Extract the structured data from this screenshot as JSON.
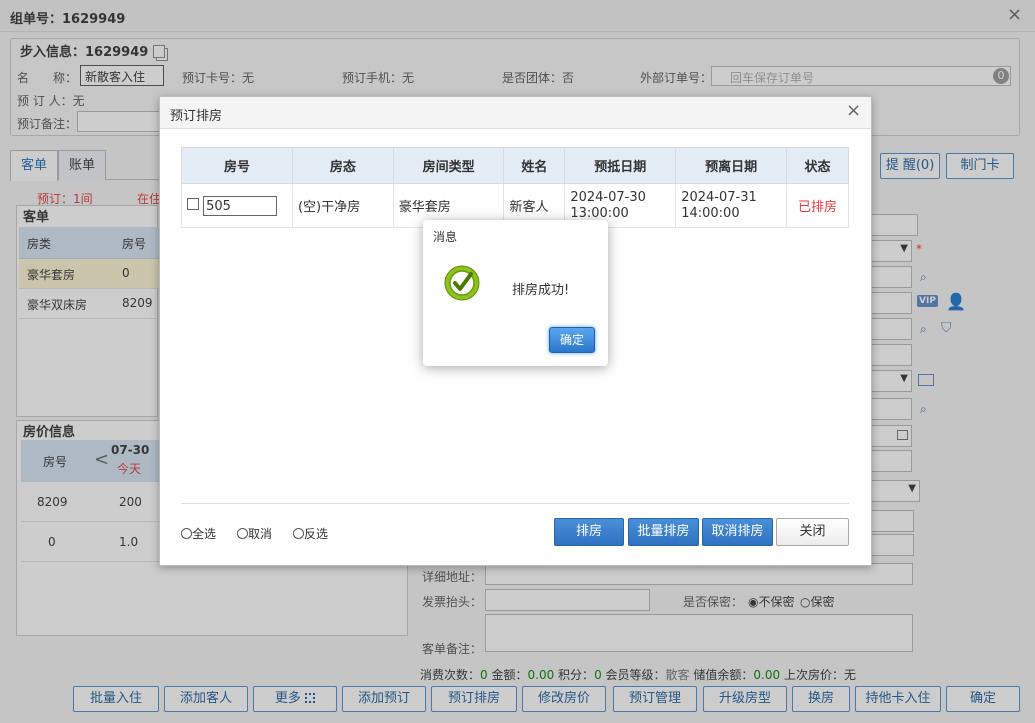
{
  "window": {
    "title": "组单号：1629949",
    "close_glyph": "×"
  },
  "checkin_info": {
    "legend": "步入信息：1629949",
    "name_label": "名　　称：",
    "name_value": "新散客入住",
    "card_label": "预订卡号：无",
    "phone_label": "预订手机：无",
    "group_label": "是否团体：否",
    "ext_order_label": "外部订单号：",
    "ext_order_placeholder": "回车保存订单号",
    "ext_order_badge": "0",
    "booker_label": "预 订 人：无",
    "remark_label": "预订备注："
  },
  "left_tabs": [
    {
      "label": "客单"
    },
    {
      "label": "账单"
    }
  ],
  "left_summary": {
    "booked": "预订：1间",
    "staying": "在住"
  },
  "guest_list": {
    "title": "客单",
    "headers": [
      "房类",
      "房号"
    ],
    "rows": [
      {
        "type": "豪华套房",
        "room": "0"
      },
      {
        "type": "豪华双床房",
        "room": "8209"
      }
    ]
  },
  "price_info": {
    "title": "房价信息",
    "col_room": "房号",
    "prev_glyph": "<",
    "date": "07-30",
    "today": "今天",
    "rows": [
      {
        "room": "8209",
        "price": "200"
      },
      {
        "room": "0",
        "price": "1.0"
      }
    ]
  },
  "right_top_buttons": [
    {
      "label": "提 醒(0)"
    },
    {
      "label": "制门卡"
    }
  ],
  "right_form": {
    "required_mark": "*",
    "vip_label": "VIP",
    "address_label": "详细地址：",
    "invoice_label": "发票抬头：",
    "confidential_label": "是否保密：",
    "opt_not_confidential": "不保密",
    "opt_confidential": "保密",
    "remark_label": "客单备注："
  },
  "stats_line": {
    "consume_label": "消费次数：",
    "consume_value": "0",
    "amount_label": "金额：",
    "amount_value": "0.00",
    "points_label": "积分：",
    "points_value": "0",
    "level_label": "会员等级：",
    "level_value": "散客",
    "balance_label": "储值余额：",
    "balance_value": "0.00",
    "last_price_label": "上次房价：",
    "last_price_value": "无"
  },
  "bottom_buttons": [
    {
      "label": "批量入住"
    },
    {
      "label": "添加客人"
    },
    {
      "label": "更多"
    },
    {
      "label": "添加预订"
    },
    {
      "label": "预订排房"
    },
    {
      "label": "修改房价"
    },
    {
      "label": "预订管理"
    },
    {
      "label": "升级房型"
    },
    {
      "label": "换房"
    },
    {
      "label": "持他卡入住"
    },
    {
      "label": "确定"
    }
  ],
  "dialog": {
    "title": "预订排房",
    "close_glyph": "×",
    "headers": [
      "房号",
      "房态",
      "房间类型",
      "姓名",
      "预抵日期",
      "预离日期",
      "状态"
    ],
    "row": {
      "room": "505",
      "status": "(空)干净房",
      "room_type": "豪华套房",
      "name": "新客人",
      "arrival_date": "2024-07-30",
      "arrival_time": "13:00:00",
      "departure_date": "2024-07-31",
      "departure_time": "14:00:00",
      "state": "已排房"
    },
    "radio_all": "全选",
    "radio_cancel": "取消",
    "radio_invert": "反选",
    "btn_assign": "排房",
    "btn_batch": "批量排房",
    "btn_cancel_assign": "取消排房",
    "btn_close": "关闭"
  },
  "message": {
    "title": "消息",
    "text": "排房成功!",
    "ok": "确定"
  },
  "colors": {
    "accent": "#2f72c0",
    "danger": "#e03a3a",
    "success": "#8dc21f"
  }
}
